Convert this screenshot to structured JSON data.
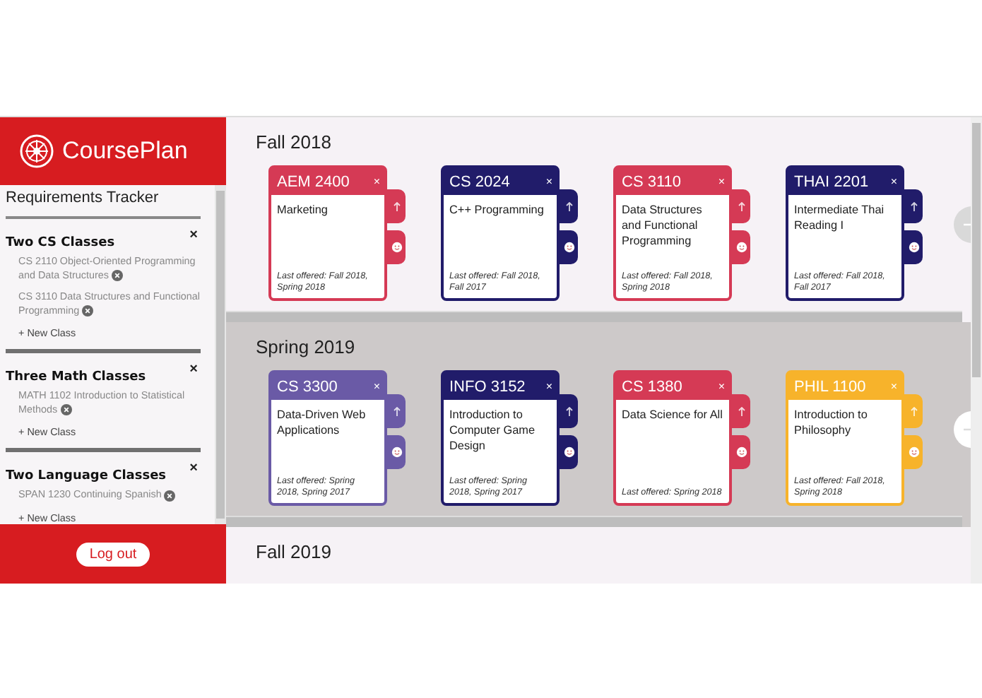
{
  "app": {
    "title": "CoursePlan"
  },
  "sidebar": {
    "heading": "Requirements Tracker",
    "groups": [
      {
        "title": "Two CS Classes",
        "close": "×",
        "classes": [
          "CS 2110 Object-Oriented Programming and Data Structures",
          "CS 3110 Data Structures and Functional Programming"
        ],
        "add": "+ New Class"
      },
      {
        "title": "Three Math Classes",
        "close": "×",
        "classes": [
          "MATH 1102 Introduction to Statistical Methods"
        ],
        "add": "+ New Class"
      },
      {
        "title": "Two Language Classes",
        "close": "×",
        "classes": [
          "SPAN 1230 Continuing Spanish"
        ],
        "add": "+ New Class"
      }
    ],
    "logout": "Log out"
  },
  "semesters": [
    {
      "title": "Fall 2018",
      "shaded": false,
      "courses": [
        {
          "code": "AEM 2400",
          "name": "Marketing",
          "offered": "Last offered: Fall 2018, Spring 2018",
          "color": "#d53a55",
          "close": "×"
        },
        {
          "code": "CS 2024",
          "name": "C++ Programming",
          "offered": "Last offered: Fall 2018, Fall 2017",
          "color": "#211c6a",
          "close": "×"
        },
        {
          "code": "CS 3110",
          "name": "Data Structures and Functional Programming",
          "offered": "Last offered: Fall 2018, Spring 2018",
          "color": "#d53a55",
          "close": "×"
        },
        {
          "code": "THAI 2201",
          "name": "Intermediate Thai Reading I",
          "offered": "Last offered: Fall 2018, Fall 2017",
          "color": "#211c6a",
          "close": "×"
        }
      ]
    },
    {
      "title": "Spring 2019",
      "shaded": true,
      "courses": [
        {
          "code": "CS 3300",
          "name": "Data-Driven Web Applications",
          "offered": "Last offered: Spring 2018, Spring 2017",
          "color": "#6a5aa6",
          "close": "×"
        },
        {
          "code": "INFO 3152",
          "name": "Introduction to Computer Game Design",
          "offered": "Last offered: Spring 2018, Spring 2017",
          "color": "#211c6a",
          "close": "×"
        },
        {
          "code": "CS 1380",
          "name": "Data Science for All",
          "offered": "Last offered: Spring 2018",
          "color": "#d53a55",
          "close": "×"
        },
        {
          "code": "PHIL 1100",
          "name": "Introduction to Philosophy",
          "offered": "Last offered: Fall 2018, Spring 2018",
          "color": "#f7b32b",
          "close": "×"
        }
      ]
    },
    {
      "title": "Fall 2019",
      "shaded": false
    }
  ]
}
